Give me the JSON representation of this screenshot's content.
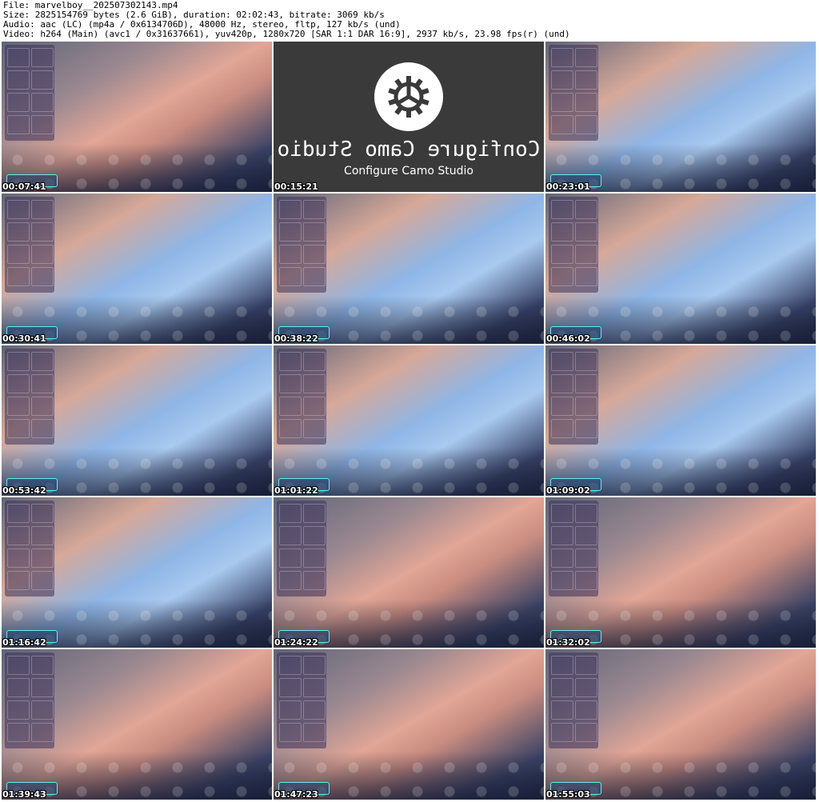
{
  "header": {
    "file": "File: marvelboy__202507302143.mp4",
    "size": "Size: 2825154769 bytes (2.6 GiB), duration: 02:02:43, bitrate: 3069 kb/s",
    "audio": "Audio: aac (LC) (mp4a / 0x6134706D), 48000 Hz, stereo, fltp, 127 kb/s (und)",
    "video": "Video: h264 (Main) (avc1 / 0x31637661), yuv420p, 1280x720 [SAR 1:1 DAR 16:9], 2937 kb/s, 23.98 fps(r) (und)"
  },
  "camo": {
    "mirrored_text": "Configure Camo Studio",
    "caption": "Configure Camo Studio"
  },
  "thumbnails": [
    {
      "timestamp": "00:07:41",
      "tone": "skin"
    },
    {
      "timestamp": "00:15:21",
      "tone": "camo"
    },
    {
      "timestamp": "00:23:01",
      "tone": "shirt"
    },
    {
      "timestamp": "00:30:41",
      "tone": "shirt"
    },
    {
      "timestamp": "00:38:22",
      "tone": "shirt"
    },
    {
      "timestamp": "00:46:02",
      "tone": "shirt"
    },
    {
      "timestamp": "00:53:42",
      "tone": "shirt"
    },
    {
      "timestamp": "01:01:22",
      "tone": "shirt"
    },
    {
      "timestamp": "01:09:02",
      "tone": "shirt"
    },
    {
      "timestamp": "01:16:42",
      "tone": "shirt"
    },
    {
      "timestamp": "01:24:22",
      "tone": "skin"
    },
    {
      "timestamp": "01:32:02",
      "tone": "skin"
    },
    {
      "timestamp": "01:39:43",
      "tone": "skin"
    },
    {
      "timestamp": "01:47:23",
      "tone": "skin"
    },
    {
      "timestamp": "01:55:03",
      "tone": "skin"
    }
  ]
}
